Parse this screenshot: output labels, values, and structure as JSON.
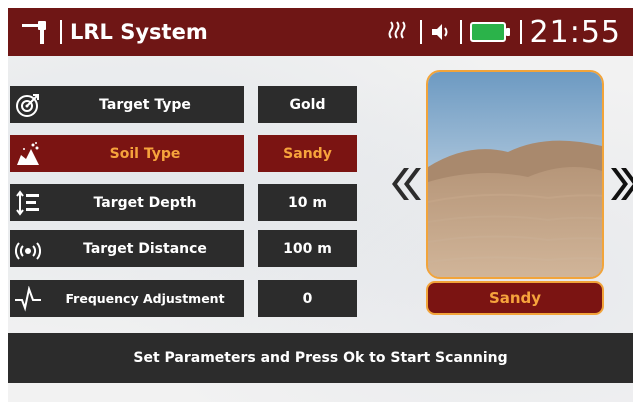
{
  "header": {
    "title": "LRL System",
    "time": "21:55",
    "icons": {
      "logo": "antenna-icon",
      "signal": "signal-icon",
      "volume": "speaker-icon",
      "battery": "battery-icon"
    },
    "battery_color": "#2bb34a"
  },
  "settings": [
    {
      "icon": "target-icon",
      "label": "Target Type",
      "value": "Gold",
      "active": false
    },
    {
      "icon": "soil-icon",
      "label": "Soil Type",
      "value": "Sandy",
      "active": true
    },
    {
      "icon": "depth-icon",
      "label": "Target Depth",
      "value": "10 m",
      "active": false
    },
    {
      "icon": "distance-icon",
      "label": "Target Distance",
      "value": "100 m",
      "active": false
    },
    {
      "icon": "frequency-icon",
      "label": "Frequency Adjustment",
      "value": "0",
      "active": false
    }
  ],
  "preview": {
    "caption": "Sandy",
    "prev_icon": "double-chevron-left-icon",
    "next_icon": "double-chevron-right-icon"
  },
  "footer": {
    "message": "Set Parameters and Press Ok to Start Scanning"
  },
  "colors": {
    "header": "#6f1615",
    "active": "#7b1412",
    "accent": "#f6a33c",
    "panel": "#2c2c2c"
  }
}
